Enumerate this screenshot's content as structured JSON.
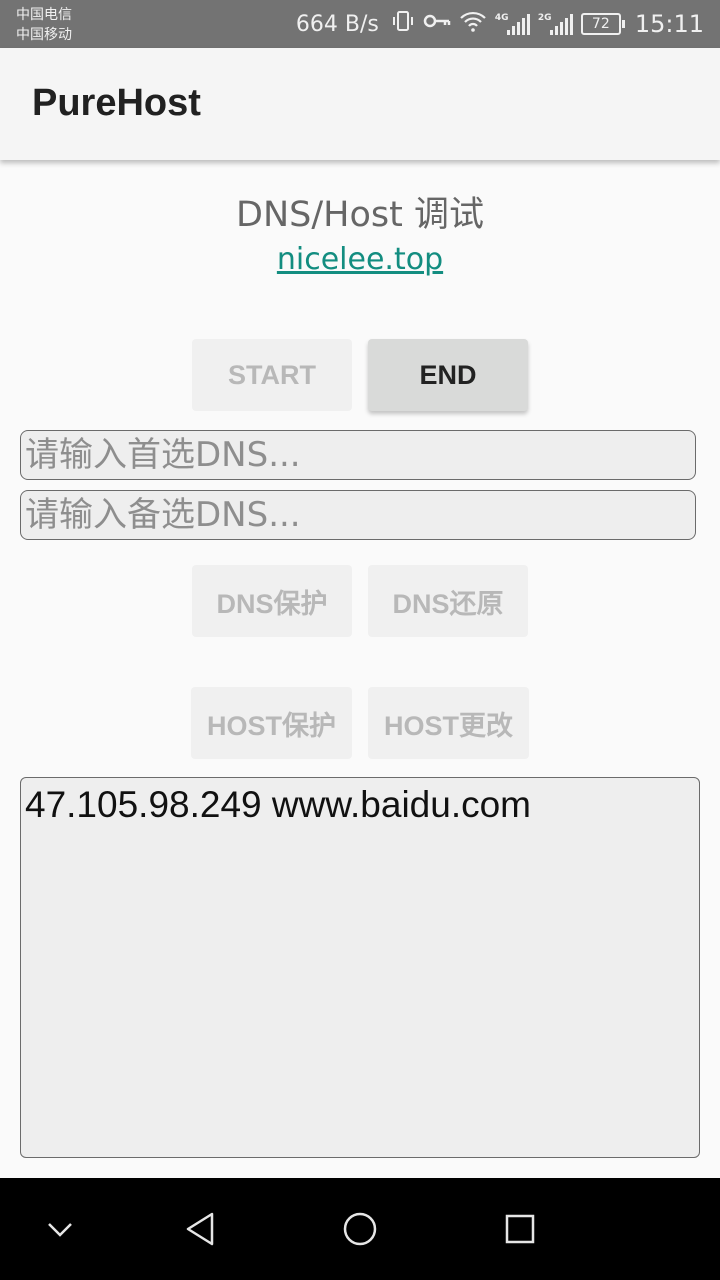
{
  "status_bar": {
    "carrier_1": "中国电信",
    "carrier_2": "中国移动",
    "network_speed": "664 B/s",
    "signal_1_tag": "4G",
    "signal_2_tag": "2G",
    "battery": "72",
    "time": "15:11",
    "icons": [
      "vibrate-icon",
      "vpn-key-icon",
      "wifi-icon",
      "signal-4g-icon",
      "signal-2g-icon",
      "battery-icon"
    ]
  },
  "app_bar": {
    "title": "PureHost"
  },
  "main": {
    "heading": "DNS/Host 调试",
    "link": "nicelee.top",
    "start_label": "START",
    "end_label": "END",
    "primary_dns_placeholder": "请输入首选DNS...",
    "secondary_dns_placeholder": "请输入备选DNS...",
    "dns_protect_label": "DNS保护",
    "dns_restore_label": "DNS还原",
    "host_protect_label": "HOST保护",
    "host_change_label": "HOST更改",
    "hosts_text": "47.105.98.249 www.baidu.com"
  },
  "nav_bar": {
    "icons": [
      "chevron-down-icon",
      "back-icon",
      "home-icon",
      "recents-icon"
    ]
  },
  "colors": {
    "link": "#138d80",
    "status_bar": "#737373",
    "enabled_button": "#d9dad9",
    "disabled_button_text": "#b8b8b8"
  }
}
